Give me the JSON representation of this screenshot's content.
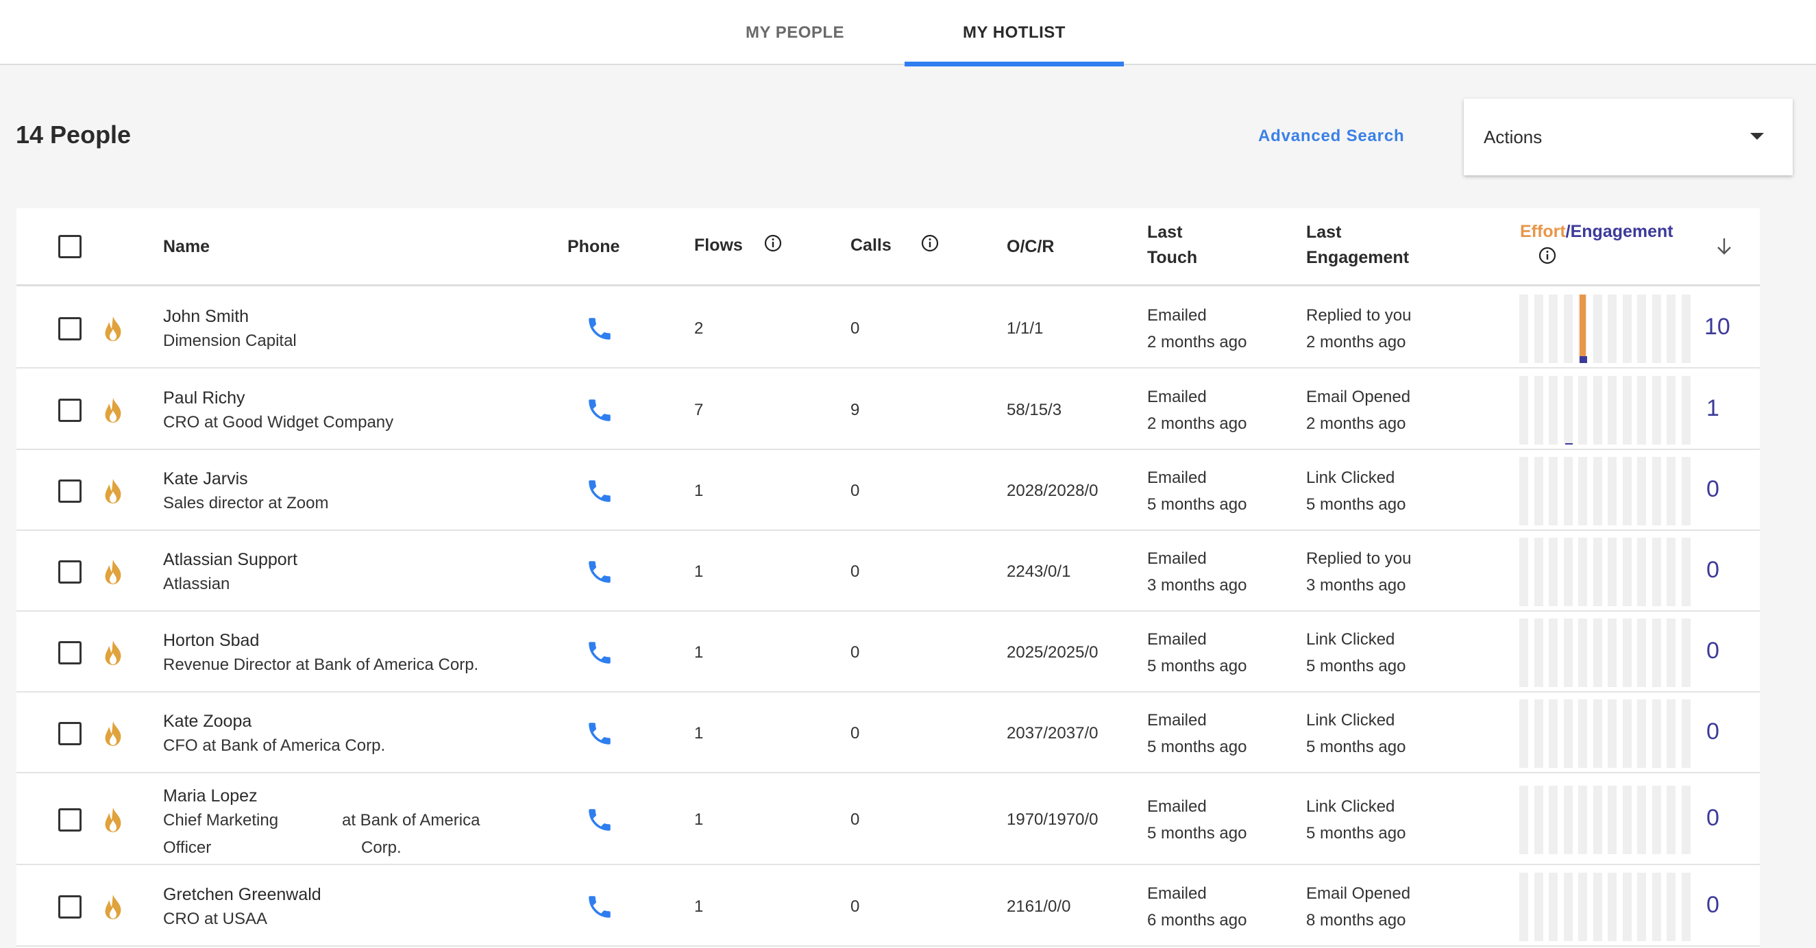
{
  "tabs": [
    {
      "label": "MY PEOPLE",
      "active": false
    },
    {
      "label": "MY HOTLIST",
      "active": true
    }
  ],
  "toolbar": {
    "people_count": "14 People",
    "advanced_search": "Advanced Search",
    "actions_label": "Actions"
  },
  "columns": {
    "name": "Name",
    "phone": "Phone",
    "flows": "Flows",
    "calls": "Calls",
    "ocr": "O/C/R",
    "last_touch_1": "Last",
    "last_touch_2": "Touch",
    "last_engagement_1": "Last",
    "last_engagement_2": "Engagement",
    "effort": "Effort",
    "slash": "/",
    "engagement": "Engagement"
  },
  "colors": {
    "accent_blue": "#2f7ef0",
    "effort_orange": "#e8964a",
    "engagement_purple": "#3c3a99",
    "flame": "#e0a23c"
  },
  "icons": {
    "hot": "flame-icon",
    "phone": "phone-icon",
    "info": "info-icon",
    "sort": "arrow-down-icon",
    "dropdown": "caret-down-icon"
  },
  "rows": [
    {
      "name": "John Smith",
      "title": "Dimension Capital",
      "flows": "2",
      "calls": "0",
      "ocr": "1/1/1",
      "touch": "Emailed",
      "touch_time": "2 months ago",
      "engagement": "Replied to you",
      "engagement_time": "2 months ago",
      "score": "10",
      "effort": [
        0,
        0,
        0,
        0,
        1,
        0,
        0,
        0,
        0,
        0,
        0,
        0
      ],
      "engaged": [
        0,
        0,
        0,
        0,
        0.2,
        0,
        0,
        0,
        0,
        0,
        0,
        0
      ]
    },
    {
      "name": "Paul Richy",
      "title": "CRO at Good Widget Company",
      "flows": "7",
      "calls": "9",
      "ocr": "58/15/3",
      "touch": "Emailed",
      "touch_time": "2 months ago",
      "engagement": "Email Opened",
      "engagement_time": "2 months ago",
      "score": "1",
      "effort": [
        0,
        0,
        0,
        0,
        0,
        0,
        0,
        0,
        0,
        0,
        0,
        0
      ],
      "engaged": [
        0,
        0,
        0,
        0.03,
        0,
        0,
        0,
        0,
        0,
        0,
        0,
        0
      ]
    },
    {
      "name": "Kate Jarvis",
      "title": "Sales director at Zoom",
      "flows": "1",
      "calls": "0",
      "ocr": "2028/2028/0",
      "touch": "Emailed",
      "touch_time": "5 months ago",
      "engagement": "Link Clicked",
      "engagement_time": "5 months ago",
      "score": "0",
      "effort": [
        0,
        0,
        0,
        0,
        0,
        0,
        0,
        0,
        0,
        0,
        0,
        0
      ],
      "engaged": [
        0,
        0,
        0,
        0,
        0,
        0,
        0,
        0,
        0,
        0,
        0,
        0
      ]
    },
    {
      "name": "Atlassian Support",
      "title": "Atlassian",
      "flows": "1",
      "calls": "0",
      "ocr": "2243/0/1",
      "touch": "Emailed",
      "touch_time": "3 months ago",
      "engagement": "Replied to you",
      "engagement_time": "3 months ago",
      "score": "0",
      "effort": [
        0,
        0,
        0,
        0,
        0,
        0,
        0,
        0,
        0,
        0,
        0,
        0
      ],
      "engaged": [
        0,
        0,
        0,
        0,
        0,
        0,
        0,
        0,
        0,
        0,
        0,
        0
      ]
    },
    {
      "name": "Horton Sbad",
      "title": "Revenue Director at Bank of America Corp.",
      "flows": "1",
      "calls": "0",
      "ocr": "2025/2025/0",
      "touch": "Emailed",
      "touch_time": "5 months ago",
      "engagement": "Link Clicked",
      "engagement_time": "5 months ago",
      "score": "0",
      "effort": [
        0,
        0,
        0,
        0,
        0,
        0,
        0,
        0,
        0,
        0,
        0,
        0
      ],
      "engaged": [
        0,
        0,
        0,
        0,
        0,
        0,
        0,
        0,
        0,
        0,
        0,
        0
      ]
    },
    {
      "name": "Kate Zoopa",
      "title": "CFO at Bank of America Corp.",
      "flows": "1",
      "calls": "0",
      "ocr": "2037/2037/0",
      "touch": "Emailed",
      "touch_time": "5 months ago",
      "engagement": "Link Clicked",
      "engagement_time": "5 months ago",
      "score": "0",
      "effort": [
        0,
        0,
        0,
        0,
        0,
        0,
        0,
        0,
        0,
        0,
        0,
        0
      ],
      "engaged": [
        0,
        0,
        0,
        0,
        0,
        0,
        0,
        0,
        0,
        0,
        0,
        0
      ]
    },
    {
      "name": "Maria Lopez",
      "title_a": "Chief Marketing",
      "title_b": "Officer",
      "title_c": "at Bank of America",
      "title_d": "Corp.",
      "flows": "1",
      "calls": "0",
      "ocr": "1970/1970/0",
      "touch": "Emailed",
      "touch_time": "5 months ago",
      "engagement": "Link Clicked",
      "engagement_time": "5 months ago",
      "score": "0",
      "effort": [
        0,
        0,
        0,
        0,
        0,
        0,
        0,
        0,
        0,
        0,
        0,
        0
      ],
      "engaged": [
        0,
        0,
        0,
        0,
        0,
        0,
        0,
        0,
        0,
        0,
        0,
        0
      ]
    },
    {
      "name": "Gretchen Greenwald",
      "title": "CRO at USAA",
      "flows": "1",
      "calls": "0",
      "ocr": "2161/0/0",
      "touch": "Emailed",
      "touch_time": "6 months ago",
      "engagement": "Email Opened",
      "engagement_time": "8 months ago",
      "score": "0",
      "effort": [
        0,
        0,
        0,
        0,
        0,
        0,
        0,
        0,
        0,
        0,
        0,
        0
      ],
      "engaged": [
        0,
        0,
        0,
        0,
        0,
        0,
        0,
        0,
        0,
        0,
        0,
        0
      ]
    }
  ]
}
